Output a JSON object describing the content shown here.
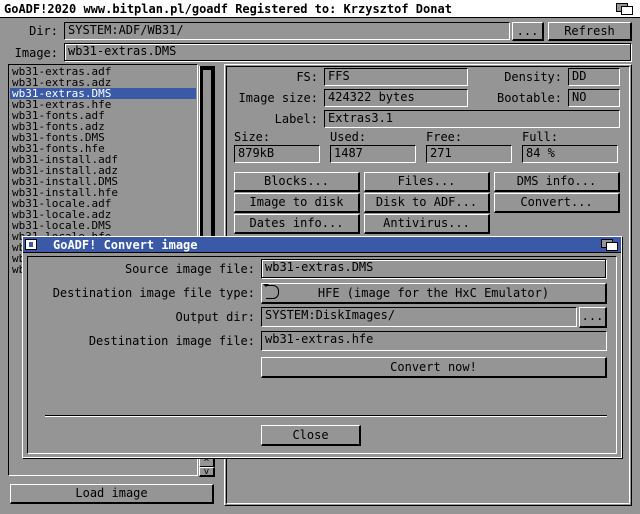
{
  "app": {
    "title": "GoADF!2020 www.bitplan.pl/goadf  Registered to: Krzysztof Donat"
  },
  "top": {
    "dir_label": "Dir:",
    "dir_value": "SYSTEM:ADF/WB31/",
    "dir_browse": "...",
    "refresh": "Refresh",
    "image_label": "Image:",
    "image_value": "wb31-extras.DMS"
  },
  "files": [
    "wb31-extras.adf",
    "wb31-extras.adz",
    "wb31-extras.DMS",
    "wb31-extras.hfe",
    "wb31-fonts.adf",
    "wb31-fonts.adz",
    "wb31-fonts.DMS",
    "wb31-fonts.hfe",
    "wb31-install.adf",
    "wb31-install.adz",
    "wb31-install.DMS",
    "wb31-install.hfe",
    "wb31-locale.adf",
    "wb31-locale.adz",
    "wb31-locale.DMS",
    "wb31-locale.hfe",
    "wb",
    "wb",
    "wb",
    "wb"
  ],
  "selected_file": "wb31-extras.DMS",
  "load_image": "Load image",
  "scroll_arrows": {
    "up": "^",
    "down": "v"
  },
  "info": {
    "fs_label": "FS:",
    "fs": "FFS",
    "density_label": "Density:",
    "density": "DD",
    "size_label": "Image size:",
    "size": "424322 bytes",
    "bootable_label": "Bootable:",
    "bootable": "NO",
    "label_label": "Label:",
    "label": "Extras3.1",
    "col_size": "Size:",
    "col_used": "Used:",
    "col_free": "Free:",
    "col_full": "Full:",
    "size_val": "879kB",
    "used_val": "1487",
    "free_val": "271",
    "full_val": "84 %"
  },
  "actions": {
    "blocks": "Blocks...",
    "files": "Files...",
    "dms_info": "DMS info...",
    "image_to_disk": "Image to disk",
    "disk_to_adf": "Disk to ADF...",
    "convert": "Convert...",
    "dates_info": "Dates info...",
    "antivirus": "Antivirus..."
  },
  "dialog": {
    "title": "GoADF! Convert image",
    "source_label": "Source image file:",
    "source_value": "wb31-extras.DMS",
    "dest_type_label": "Destination image file type:",
    "dest_type_value": "HFE (image for the HxC Emulator)",
    "output_label": "Output dir:",
    "output_value": "SYSTEM:DiskImages/",
    "output_browse": "...",
    "dest_file_label": "Destination image file:",
    "dest_file_value": "wb31-extras.hfe",
    "convert_now": "Convert now!",
    "progress": 0,
    "close": "Close"
  }
}
